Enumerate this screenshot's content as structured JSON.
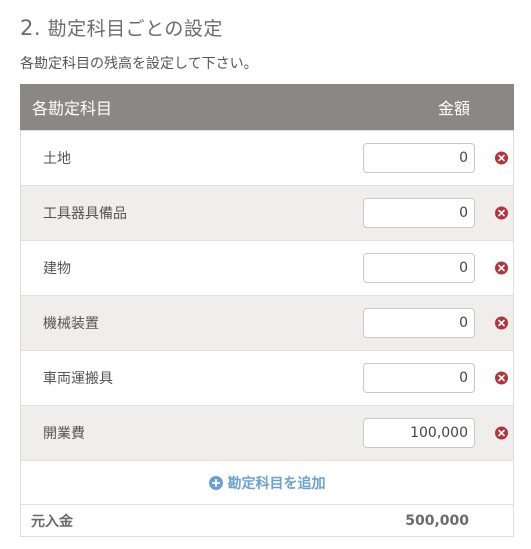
{
  "section": {
    "number": "2.",
    "title": "勘定科目ごとの設定",
    "description": "各勘定科目の残高を設定して下さい。"
  },
  "table": {
    "header_account": "各勘定科目",
    "header_amount": "金額",
    "rows": [
      {
        "label": "土地",
        "value": "0"
      },
      {
        "label": "工具器具備品",
        "value": "0"
      },
      {
        "label": "建物",
        "value": "0"
      },
      {
        "label": "機械装置",
        "value": "0"
      },
      {
        "label": "車両運搬具",
        "value": "0"
      },
      {
        "label": "開業費",
        "value": "100,000"
      }
    ],
    "add_label": "勘定科目を追加",
    "total_label": "元入金",
    "total_value": "500,000"
  },
  "colors": {
    "header_bg": "#8a8884",
    "remove_icon": "#b5323a",
    "link": "#6aa0d8",
    "row_alt_bg": "#efeeec"
  },
  "icons": {
    "remove": "times-circle-icon",
    "add": "plus-circle-icon"
  }
}
